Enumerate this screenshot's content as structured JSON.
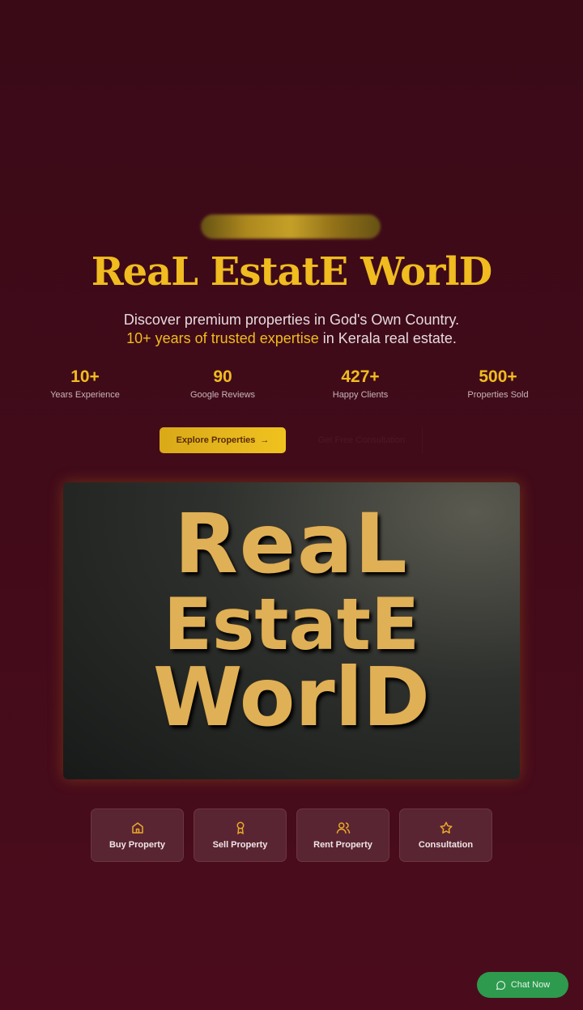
{
  "header": {
    "logo_icon": "blurred-logo",
    "title": "ReaL EstatE WorlD"
  },
  "hero": {
    "subtitle_line1": "Discover premium properties in God's Own Country.",
    "subtitle_highlight": "10+ years of trusted expertise",
    "subtitle_rest": " in Kerala real estate.",
    "stats": [
      {
        "value": "10+",
        "label": "Years Experience"
      },
      {
        "value": "90",
        "label": "Google Reviews"
      },
      {
        "value": "427+",
        "label": "Happy Clients"
      },
      {
        "value": "500+",
        "label": "Properties Sold"
      }
    ],
    "primary_button": "Explore Properties",
    "secondary_button": "Get Free Consultation",
    "image_logo_text": [
      "ReaL",
      "EstatE",
      "WorlD"
    ]
  },
  "services": [
    {
      "label": "Buy Property",
      "icon": "home-icon"
    },
    {
      "label": "Sell Property",
      "icon": "award-icon"
    },
    {
      "label": "Rent Property",
      "icon": "users-icon"
    },
    {
      "label": "Consultation",
      "icon": "star-icon"
    }
  ],
  "chat": {
    "label": "Chat Now",
    "icon": "whatsapp-icon"
  },
  "colors": {
    "background": "#420b1a",
    "accent": "#f0bc1f",
    "chat": "#2d9a4e"
  }
}
